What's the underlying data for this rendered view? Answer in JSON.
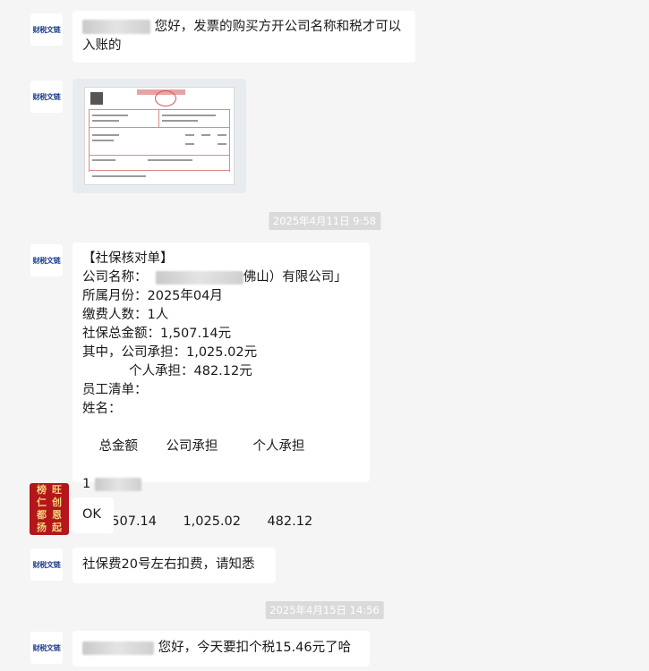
{
  "messages": {
    "m1": {
      "text": "您好，发票的购买方开公司名称和税才可以入账的"
    },
    "time1": "2025年4月11日 9:58",
    "m3": {
      "title": "【社保核对单】",
      "company_label": "公司名称：",
      "company_suffix": "佛山）有限公司」",
      "month": "所属月份：2025年04月",
      "people": "缴费人数：1人",
      "total": "社保总金额：1,507.14元",
      "company_share": "其中，公司承担：1,025.02元",
      "personal_share": "个人承担：482.12元",
      "list_label": "员工清单：",
      "name_label": "姓名：",
      "headers": [
        "总金额",
        "公司承担",
        "个人承担"
      ],
      "row_prefix": "1",
      "values": [
        "1,507.14",
        "1,025.02",
        "482.12"
      ]
    },
    "m4": {
      "text": "OK"
    },
    "m5": {
      "text": "社保费20号左右扣费，请知悉"
    },
    "time2": "2025年4月15日 14:56",
    "m6": {
      "text": "您好，今天要扣个税15.46元了哈"
    }
  },
  "avatar_logo": "财税文链",
  "red_avatar_chars": [
    "榜",
    "旺",
    "仁",
    "创",
    "都",
    "恩",
    "扬",
    "起"
  ]
}
